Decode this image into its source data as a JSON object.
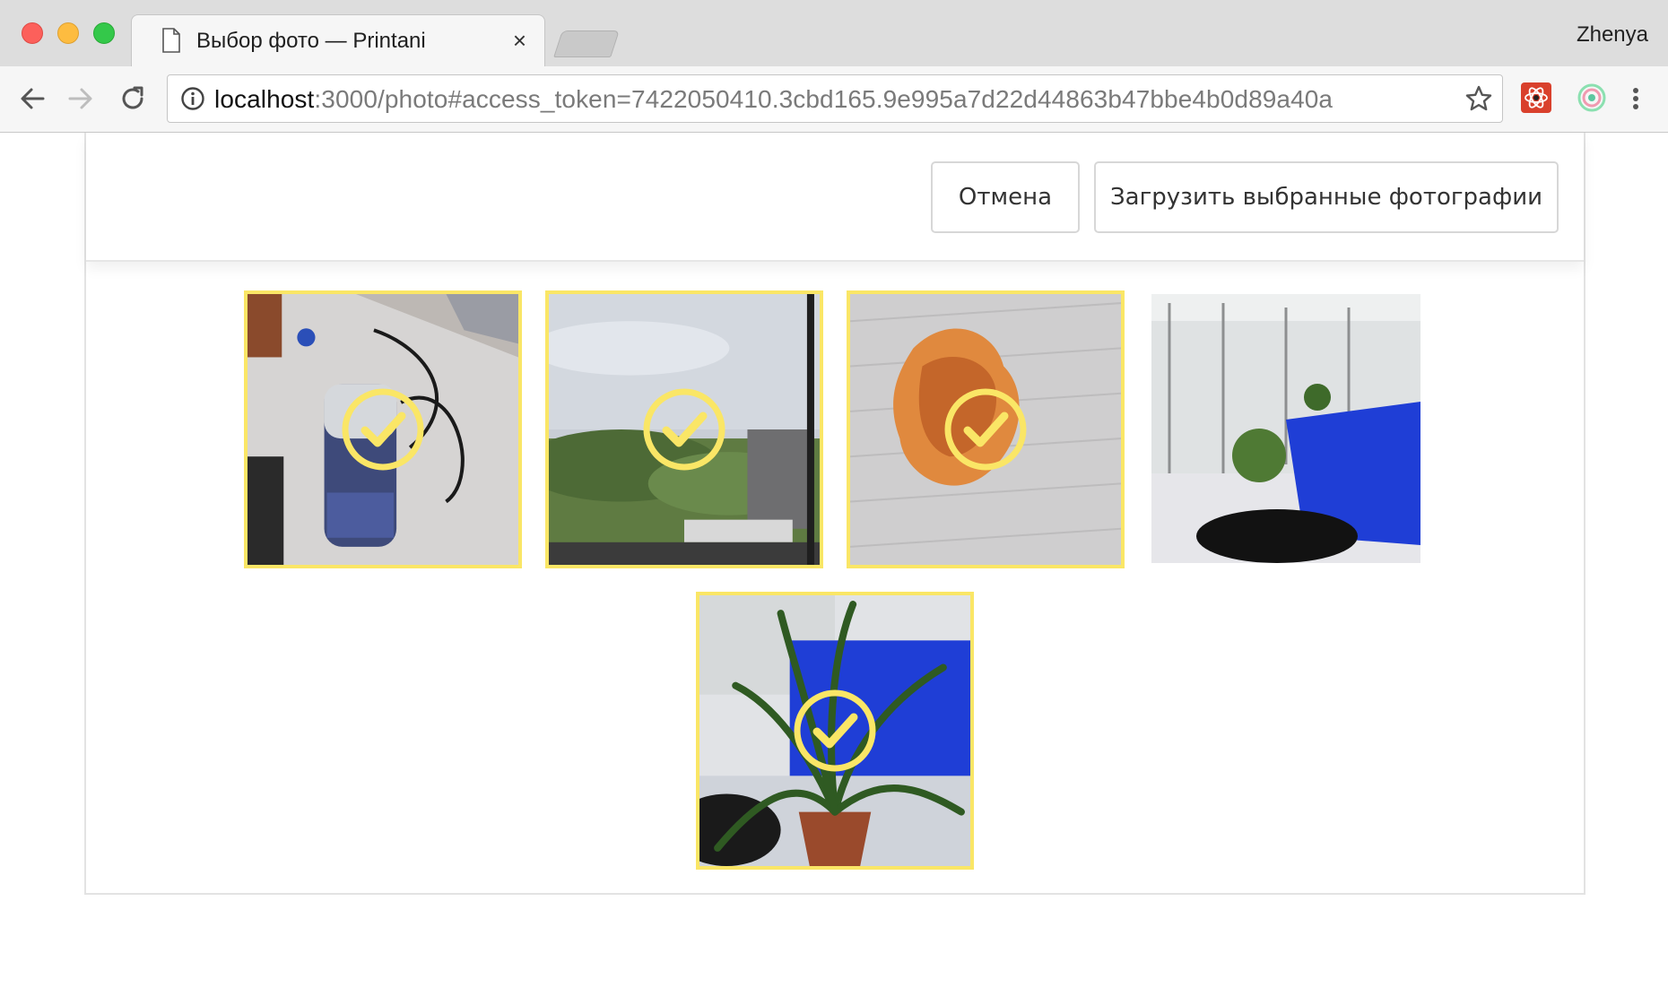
{
  "browser": {
    "tab_title": "Выбор фото — Printani",
    "tab_close": "×",
    "profile_name": "Zhenya",
    "url_host": "localhost",
    "url_rest": ":3000/photo#access_token=7422050410.3cbd165.9e995a7d22d44863b47bbe4b0d89a40a",
    "icons": [
      "back-icon",
      "forward-icon",
      "reload-icon",
      "info-icon",
      "star-icon",
      "menu-icon"
    ]
  },
  "header": {
    "cancel_label": "Отмена",
    "upload_label": "Загрузить выбранные фотографии"
  },
  "photos": [
    {
      "subject": "desk with water bottle",
      "selected": true
    },
    {
      "subject": "sky and trees",
      "selected": true
    },
    {
      "subject": "dried orange peel",
      "selected": true
    },
    {
      "subject": "office interior",
      "selected": false
    },
    {
      "subject": "potted plant",
      "selected": true
    }
  ],
  "colors": {
    "selected_border": "#fae666",
    "check_mark": "#fae666",
    "accent_blue": "#1f3ed6"
  }
}
